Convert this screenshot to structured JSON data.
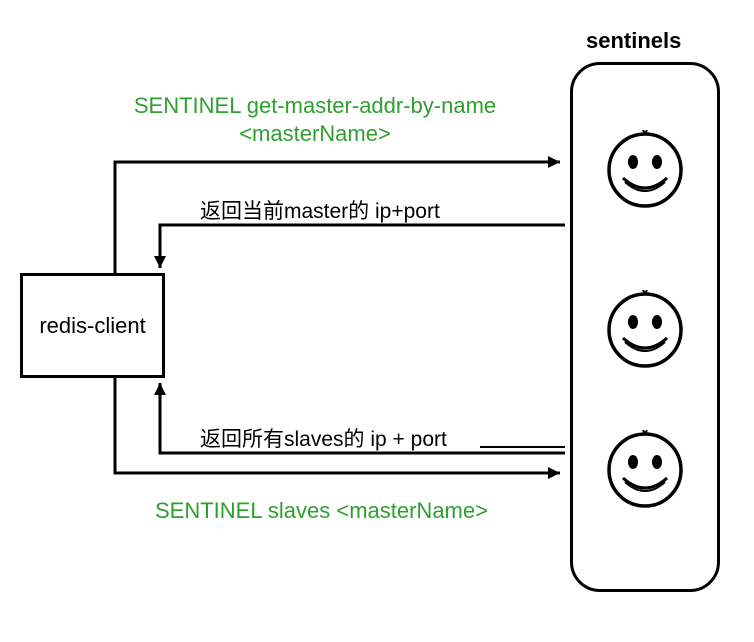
{
  "title": "sentinels",
  "client": {
    "label": "redis-client"
  },
  "commands": {
    "get_master_line1": "SENTINEL get-master-addr-by-name",
    "get_master_line2": "<masterName>",
    "slaves": "SENTINEL slaves <masterName>"
  },
  "responses": {
    "master": "返回当前master的 ip+port",
    "slaves": "返回所有slaves的 ip + port"
  }
}
